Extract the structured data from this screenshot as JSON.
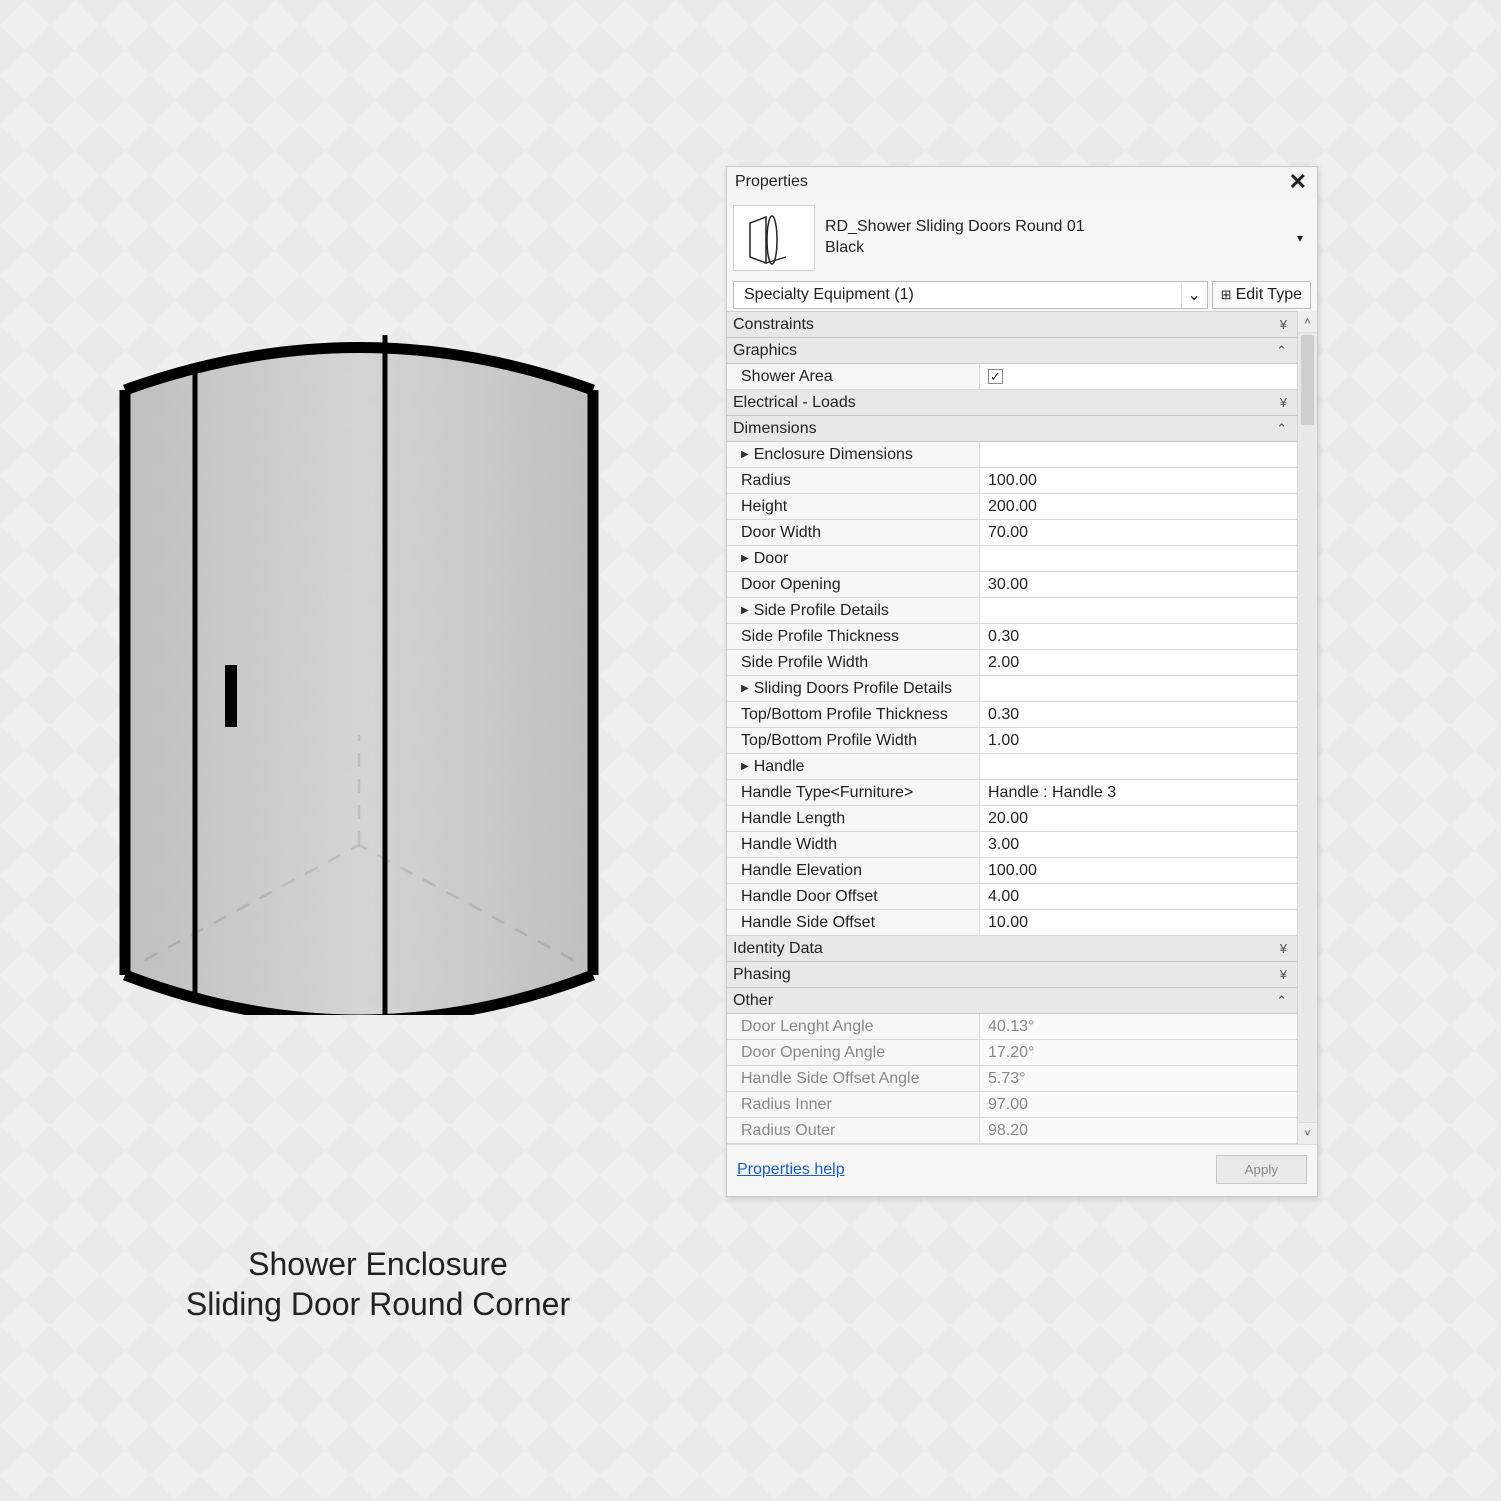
{
  "caption_line1": "Shower Enclosure",
  "caption_line2": "Sliding Door Round Corner",
  "panel": {
    "title": "Properties",
    "type_name": "RD_Shower Sliding Doors Round 01",
    "type_variant": "Black",
    "category_selector": "Specialty Equipment (1)",
    "edit_type_label": "Edit Type",
    "help_link": "Properties help",
    "apply_label": "Apply"
  },
  "groups": {
    "constraints": "Constraints",
    "graphics": "Graphics",
    "electrical": "Electrical - Loads",
    "dimensions": "Dimensions",
    "identity": "Identity Data",
    "phasing": "Phasing",
    "other": "Other"
  },
  "rows": {
    "shower_area": {
      "label": "Shower Area",
      "checked": true
    },
    "enclosure_dims": {
      "label": "Enclosure Dimensions"
    },
    "radius": {
      "label": "Radius",
      "value": "100.00"
    },
    "height": {
      "label": "Height",
      "value": "200.00"
    },
    "door_width": {
      "label": "Door Width",
      "value": "70.00"
    },
    "door": {
      "label": "Door"
    },
    "door_opening": {
      "label": "Door Opening",
      "value": "30.00"
    },
    "side_profile_details": {
      "label": "Side Profile Details"
    },
    "side_profile_thickness": {
      "label": "Side Profile Thickness",
      "value": "0.30"
    },
    "side_profile_width": {
      "label": "Side Profile Width",
      "value": "2.00"
    },
    "sliding_profile_details": {
      "label": "Sliding Doors Profile Details"
    },
    "tb_profile_thickness": {
      "label": "Top/Bottom Profile Thickness",
      "value": "0.30"
    },
    "tb_profile_width": {
      "label": "Top/Bottom Profile Width",
      "value": "1.00"
    },
    "handle": {
      "label": "Handle"
    },
    "handle_type": {
      "label": "Handle Type<Furniture>",
      "value": "Handle : Handle 3"
    },
    "handle_length": {
      "label": "Handle Length",
      "value": "20.00"
    },
    "handle_width": {
      "label": "Handle Width",
      "value": "3.00"
    },
    "handle_elevation": {
      "label": "Handle Elevation",
      "value": "100.00"
    },
    "handle_door_offset": {
      "label": "Handle Door Offset",
      "value": "4.00"
    },
    "handle_side_offset": {
      "label": "Handle Side Offset",
      "value": "10.00"
    },
    "door_length_angle": {
      "label": "Door Lenght Angle",
      "value": "40.13°"
    },
    "door_opening_angle": {
      "label": "Door Opening Angle",
      "value": "17.20°"
    },
    "handle_side_offset_angle": {
      "label": "Handle Side Offset Angle",
      "value": "5.73°"
    },
    "radius_inner": {
      "label": "Radius Inner",
      "value": "97.00"
    },
    "radius_outer": {
      "label": "Radius Outer",
      "value": "98.20"
    }
  }
}
